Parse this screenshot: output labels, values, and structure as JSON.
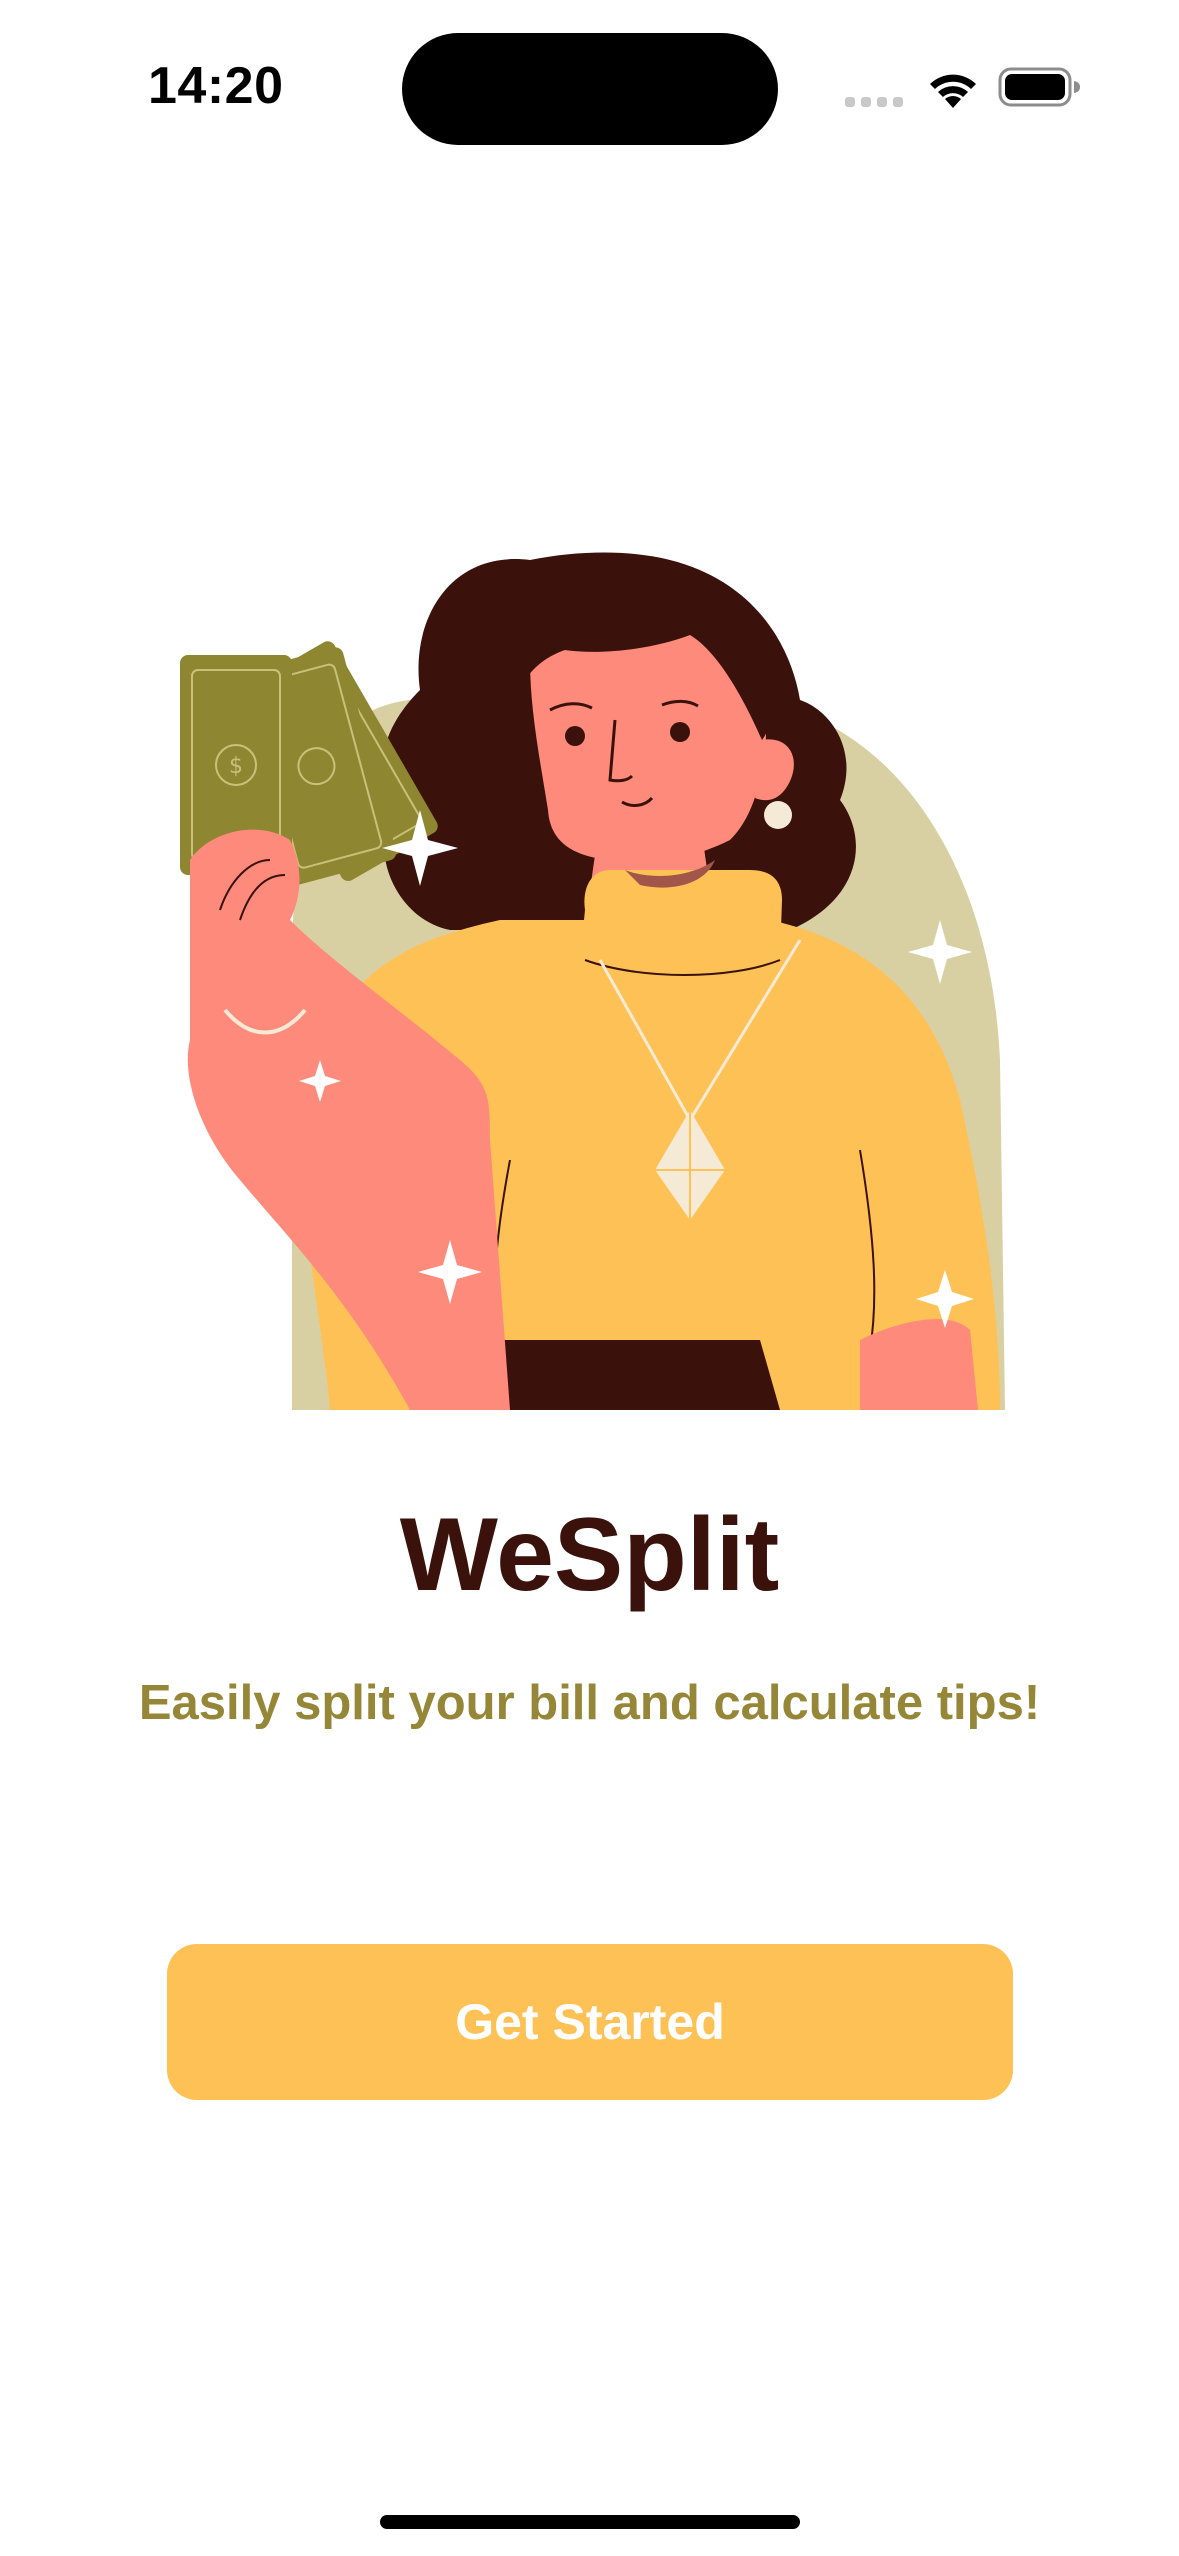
{
  "status_bar": {
    "time": "14:20",
    "icons": [
      "cellular-signal-icon",
      "wifi-icon",
      "battery-icon"
    ]
  },
  "illustration": {
    "subject": "woman-holding-money-illustration",
    "colors": {
      "hair": "#3a120b",
      "skin": "#fd8a7b",
      "sweater": "#fec155",
      "arch": "#d8d0a3",
      "bills": "#8f8631",
      "belt": "#3a120b"
    }
  },
  "main": {
    "title": "WeSplit",
    "subtitle": "Easily split your bill and calculate tips!"
  },
  "actions": {
    "get_started_label": "Get Started"
  },
  "theme": {
    "title_color": "#3a120b",
    "subtitle_color": "#958737",
    "button_color": "#fec155",
    "button_text_color": "#ffffff"
  }
}
